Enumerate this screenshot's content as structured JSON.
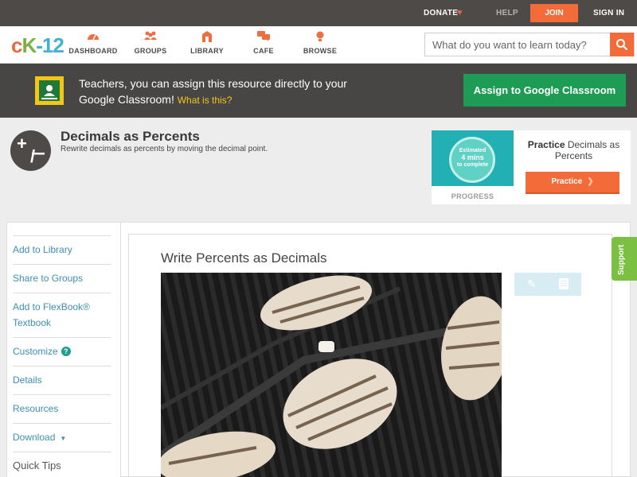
{
  "topbar": {
    "donate": "DONATE",
    "help": "HELP",
    "join": "JOIN",
    "signin": "SIGN IN"
  },
  "logo": {
    "c": "c",
    "k": "K",
    "num": "-12"
  },
  "nav": [
    {
      "label": "DASHBOARD",
      "icon": "dashboard-icon"
    },
    {
      "label": "GROUPS",
      "icon": "groups-icon"
    },
    {
      "label": "LIBRARY",
      "icon": "library-icon"
    },
    {
      "label": "CAFE",
      "icon": "cafe-icon"
    },
    {
      "label": "BROWSE",
      "icon": "browse-icon"
    }
  ],
  "search": {
    "placeholder": "What do you want to learn today?"
  },
  "banner": {
    "text": "Teachers, you can assign this resource directly to your Google Classroom!",
    "what": "What is this?",
    "button": "Assign to Google Classroom"
  },
  "concept": {
    "title": "Decimals as Percents",
    "description": "Rewrite decimals as percents by moving the decimal point."
  },
  "practice": {
    "estimated": "Estimated",
    "mins": "4 mins",
    "to_complete": "to complete",
    "progress_label": "PROGRESS",
    "title_bold": "Practice",
    "title_rest": "Decimals as Percents",
    "button": "Practice"
  },
  "sidebar": {
    "items": [
      {
        "label": "Add to Library"
      },
      {
        "label": "Share to Groups"
      },
      {
        "label": "Add to FlexBook® Textbook"
      },
      {
        "label": "Customize"
      },
      {
        "label": "Details"
      },
      {
        "label": "Resources"
      },
      {
        "label": "Download"
      }
    ],
    "quick_tips": "Quick Tips",
    "help_glyph": "?"
  },
  "main": {
    "title": "Write Percents as Decimals"
  },
  "support": "Support",
  "colors": {
    "accent": "#f46b3a",
    "google_green": "#1e9c55",
    "link": "#3d8fb4",
    "support": "#7bc043"
  }
}
